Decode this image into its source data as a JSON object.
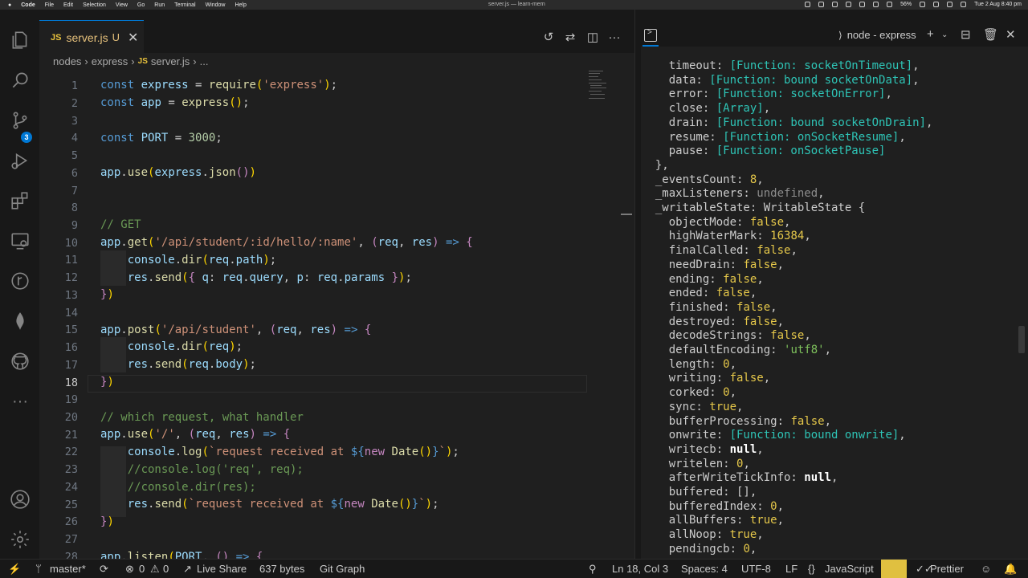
{
  "menubar": {
    "app": "Code",
    "items": [
      "File",
      "Edit",
      "Selection",
      "View",
      "Go",
      "Run",
      "Terminal",
      "Window",
      "Help"
    ],
    "window_title": "server.js — learn-mern",
    "battery": "56%",
    "clock": "Tue 2 Aug  8:40 pm"
  },
  "activity_bar": {
    "source_control_badge": "3",
    "icons": [
      "explorer-icon",
      "search-icon",
      "source-control-icon",
      "run-debug-icon",
      "extensions-icon",
      "remote-explorer-icon",
      "git-graph-icon",
      "mongodb-icon",
      "github-icon",
      "more-icon",
      "account-icon",
      "settings-gear-icon"
    ]
  },
  "editor": {
    "tab": {
      "file_icon": "JS",
      "name": "server.js",
      "status": "U",
      "close": "✕"
    },
    "breadcrumb": [
      "nodes",
      "express",
      "server.js",
      "..."
    ],
    "breadcrumb_file_icon": "JS",
    "line_numbers": [
      "1",
      "2",
      "3",
      "4",
      "5",
      "6",
      "7",
      "8",
      "9",
      "10",
      "11",
      "12",
      "13",
      "14",
      "15",
      "16",
      "17",
      "18",
      "19",
      "20",
      "21",
      "22",
      "23",
      "24",
      "25",
      "26",
      "27",
      "28"
    ],
    "current_line": "18"
  },
  "terminal": {
    "title": "node - express",
    "lines": [
      "    timeout: [Function: socketOnTimeout],",
      "    data: [Function: bound socketOnData],",
      "    error: [Function: socketOnError],",
      "    close: [Array],",
      "    drain: [Function: bound socketOnDrain],",
      "    resume: [Function: onSocketResume],",
      "    pause: [Function: onSocketPause]",
      "  },",
      "  _eventsCount: 8,",
      "  _maxListeners: undefined,",
      "  _writableState: WritableState {",
      "    objectMode: false,",
      "    highWaterMark: 16384,",
      "    finalCalled: false,",
      "    needDrain: false,",
      "    ending: false,",
      "    ended: false,",
      "    finished: false,",
      "    destroyed: false,",
      "    decodeStrings: false,",
      "    defaultEncoding: 'utf8',",
      "    length: 0,",
      "    writing: false,",
      "    corked: 0,",
      "    sync: true,",
      "    bufferProcessing: false,",
      "    onwrite: [Function: bound onwrite],",
      "    writecb: null,",
      "    writelen: 0,",
      "    afterWriteTickInfo: null,",
      "    buffered: [],",
      "    bufferedIndex: 0,",
      "    allBuffers: true,",
      "    allNoop: true,",
      "    pendingcb: 0,"
    ]
  },
  "statusbar": {
    "branch": "master*",
    "errors": "0",
    "warnings": "0",
    "live_share": "Live Share",
    "size": "637 bytes",
    "git_graph": "Git Graph",
    "position": "Ln 18, Col 3",
    "spaces": "Spaces: 4",
    "encoding": "UTF-8",
    "eol": "LF",
    "language": "JavaScript",
    "prettier": "Prettier"
  },
  "colors": {
    "accent": "#0078d4",
    "string": "#ce9178",
    "keyword": "#569cd6",
    "function": "#dcdcaa",
    "terminal_function": "#2ec4b6",
    "terminal_boolean": "#e6c84a"
  }
}
